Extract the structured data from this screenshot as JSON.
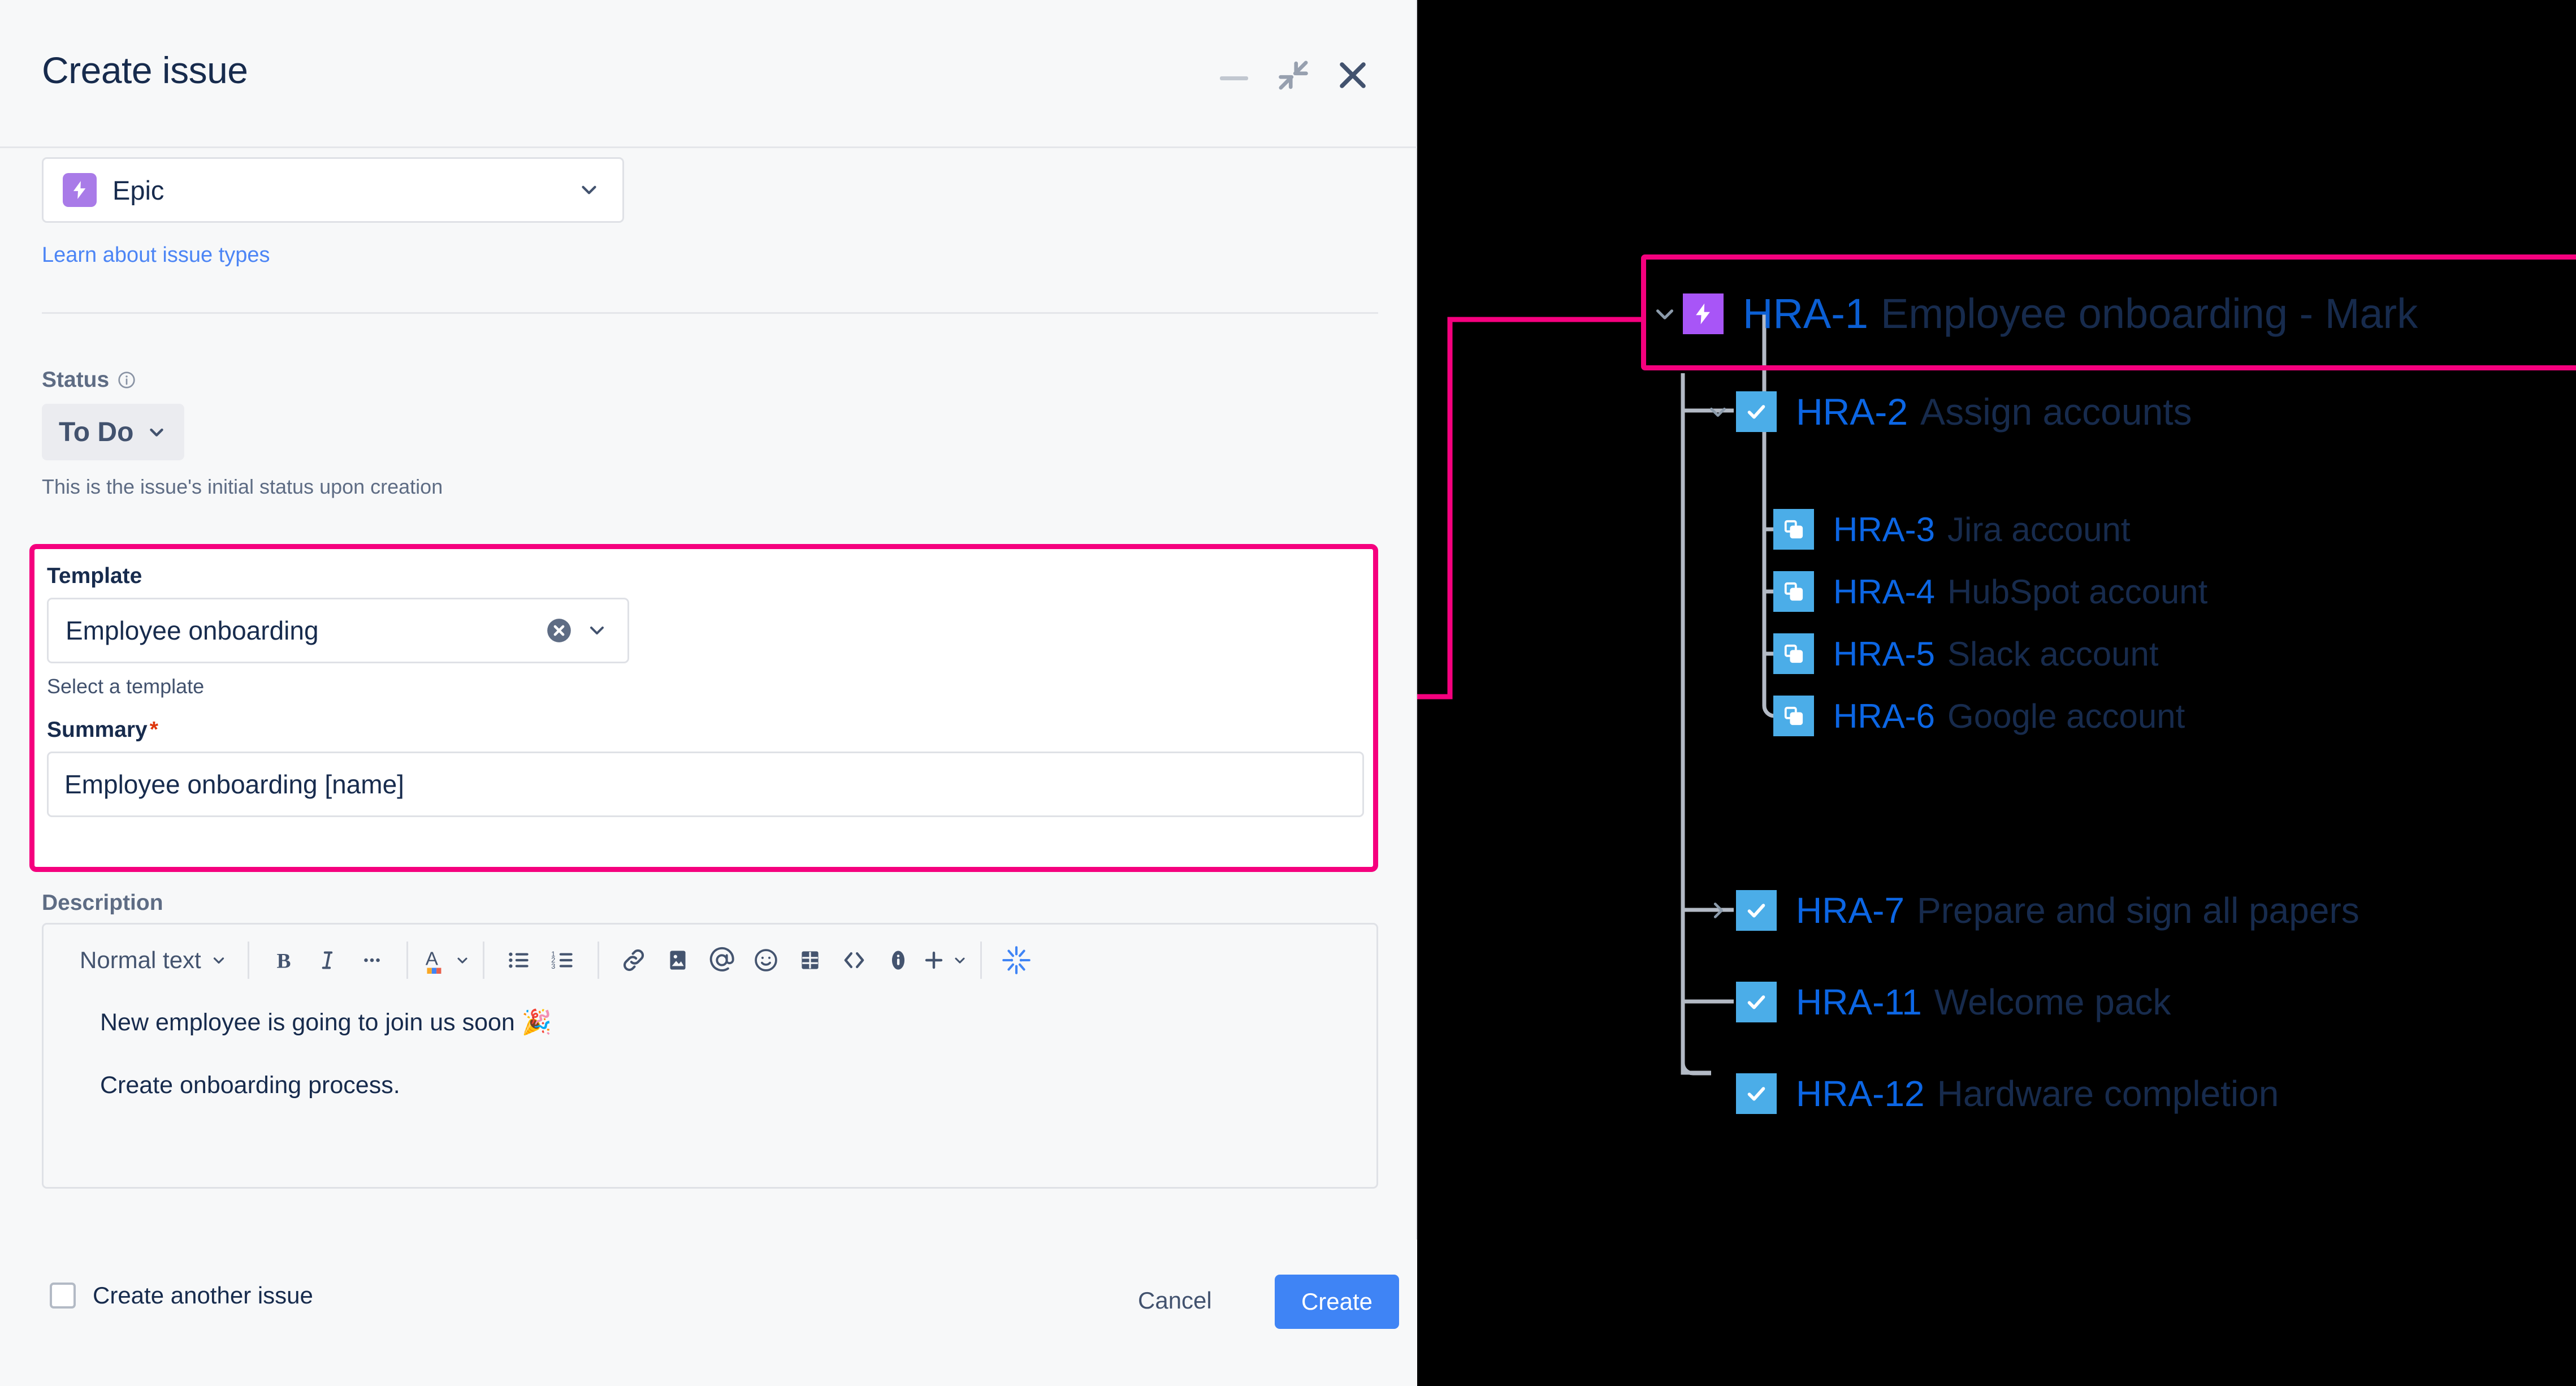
{
  "modal": {
    "title": "Create issue",
    "window_controls": [
      {
        "name": "minimize",
        "label": "Minimize"
      },
      {
        "name": "restore",
        "label": "Restore down"
      },
      {
        "name": "close",
        "label": "Close"
      }
    ],
    "issue_type": {
      "value": "Epic",
      "icon": "epic-icon",
      "icon_color": "#A97BE8"
    },
    "learn_link": "Learn about issue types",
    "status": {
      "label": "Status",
      "info_icon": "info-icon",
      "value": "To Do",
      "help": "This is the issue's initial status upon creation"
    },
    "template": {
      "label": "Template",
      "value": "Employee onboarding",
      "placeholder": "Select a template",
      "help": "Select a template",
      "clear_icon": "clear-icon",
      "chevron_icon": "chevron-down-icon"
    },
    "summary": {
      "label": "Summary",
      "required_mark": "*",
      "value": "Employee onboarding [name]",
      "placeholder": "Summary"
    },
    "description": {
      "label": "Description",
      "toolbar": {
        "text_style": "Normal text",
        "items": [
          {
            "name": "bold-icon",
            "label": "B"
          },
          {
            "name": "italic-icon",
            "label": "I"
          },
          {
            "name": "more-formatting-icon",
            "label": "•••"
          },
          {
            "name": "text-color-icon",
            "label": "A"
          },
          {
            "name": "bullet-list-icon",
            "label": "Bulleted list"
          },
          {
            "name": "numbered-list-icon",
            "label": "Numbered list"
          },
          {
            "name": "link-icon",
            "label": "Link"
          },
          {
            "name": "image-icon",
            "label": "Image"
          },
          {
            "name": "mention-icon",
            "label": "Mention"
          },
          {
            "name": "emoji-icon",
            "label": "Emoji"
          },
          {
            "name": "table-icon",
            "label": "Table"
          },
          {
            "name": "code-icon",
            "label": "Code snippet"
          },
          {
            "name": "info-panel-icon",
            "label": "Info panel"
          },
          {
            "name": "insert-more-icon",
            "label": "Insert more"
          },
          {
            "name": "ai-sparkle-icon",
            "label": "AI"
          }
        ]
      },
      "paragraphs": [
        "New employee is going to join us soon 🎉",
        "Create onboarding process."
      ]
    },
    "footer": {
      "create_another_label": "Create another issue",
      "create_another_checked": false,
      "cancel_label": "Cancel",
      "create_label": "Create"
    },
    "highlight_color": "#F5007E"
  },
  "tree": {
    "highlight_color": "#F5007E",
    "connector_color": "#B3BAC5",
    "rows": [
      {
        "id": "1",
        "key": "HRA-1",
        "title": "Employee onboarding - Mark",
        "icon": "epic-icon",
        "chevron": "expanded",
        "depth": 0
      },
      {
        "id": "2",
        "key": "HRA-2",
        "title": "Assign accounts",
        "icon": "task-icon",
        "chevron": "expanded",
        "depth": 1
      },
      {
        "id": "3",
        "key": "HRA-3",
        "title": "Jira account",
        "icon": "subtask-icon",
        "chevron": "none",
        "depth": 2
      },
      {
        "id": "4",
        "key": "HRA-4",
        "title": "HubSpot account",
        "icon": "subtask-icon",
        "chevron": "none",
        "depth": 2
      },
      {
        "id": "5",
        "key": "HRA-5",
        "title": "Slack account",
        "icon": "subtask-icon",
        "chevron": "none",
        "depth": 2
      },
      {
        "id": "6",
        "key": "HRA-6",
        "title": "Google account",
        "icon": "subtask-icon",
        "chevron": "none",
        "depth": 2
      },
      {
        "id": "7",
        "key": "HRA-7",
        "title": "Prepare and sign all papers",
        "icon": "task-icon",
        "chevron": "collapsed",
        "depth": 1
      },
      {
        "id": "11",
        "key": "HRA-11",
        "title": "Welcome pack",
        "icon": "task-icon",
        "chevron": "none",
        "depth": 1
      },
      {
        "id": "12",
        "key": "HRA-12",
        "title": "Hardware completion",
        "icon": "task-icon",
        "chevron": "none",
        "depth": 1
      }
    ]
  }
}
